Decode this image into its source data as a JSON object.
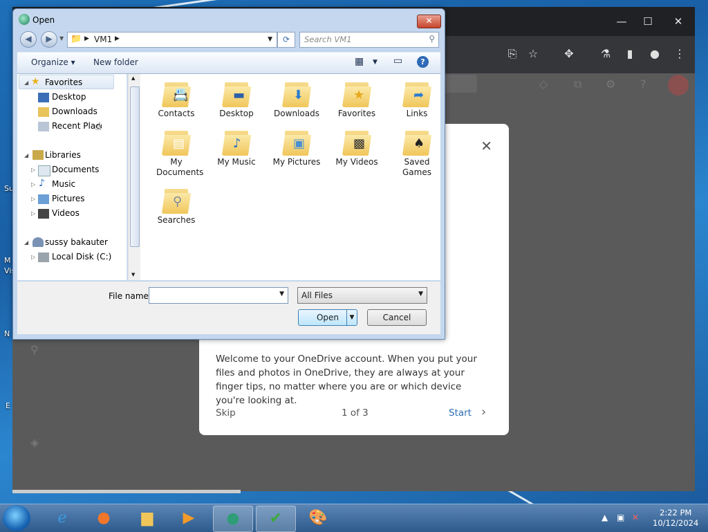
{
  "open_dialog": {
    "title": "Open",
    "address": "VM1",
    "search_placeholder": "Search VM1",
    "toolbar": {
      "organize": "Organize ▾",
      "new_folder": "New folder"
    },
    "nav": {
      "favorites": "Favorites",
      "desktop": "Desktop",
      "downloads": "Downloads",
      "recent": "Recent Places",
      "libraries": "Libraries",
      "documents": "Documents",
      "music": "Music",
      "pictures": "Pictures",
      "videos": "Videos",
      "user": "sussy bakauter",
      "local_disk": "Local Disk (C:)"
    },
    "files": [
      {
        "label": "Contacts"
      },
      {
        "label": "Desktop"
      },
      {
        "label": "Downloads"
      },
      {
        "label": "Favorites"
      },
      {
        "label": "Links"
      },
      {
        "label": "My Documents"
      },
      {
        "label": "My Music"
      },
      {
        "label": "My Pictures"
      },
      {
        "label": "My Videos"
      },
      {
        "label": "Saved Games"
      },
      {
        "label": "Searches"
      }
    ],
    "file_name_label": "File name:",
    "file_name_value": "",
    "file_type": "All Files",
    "open_button": "Open",
    "cancel_button": "Cancel"
  },
  "onedrive": {
    "text": "Welcome to your OneDrive account. When you put your files and photos in OneDrive, they are always at your finger tips, no matter where you are or which device you're looking at.",
    "skip": "Skip",
    "page": "1 of 3",
    "start": "Start"
  },
  "taskbar": {
    "time": "2:22 PM",
    "date": "10/12/2024"
  }
}
